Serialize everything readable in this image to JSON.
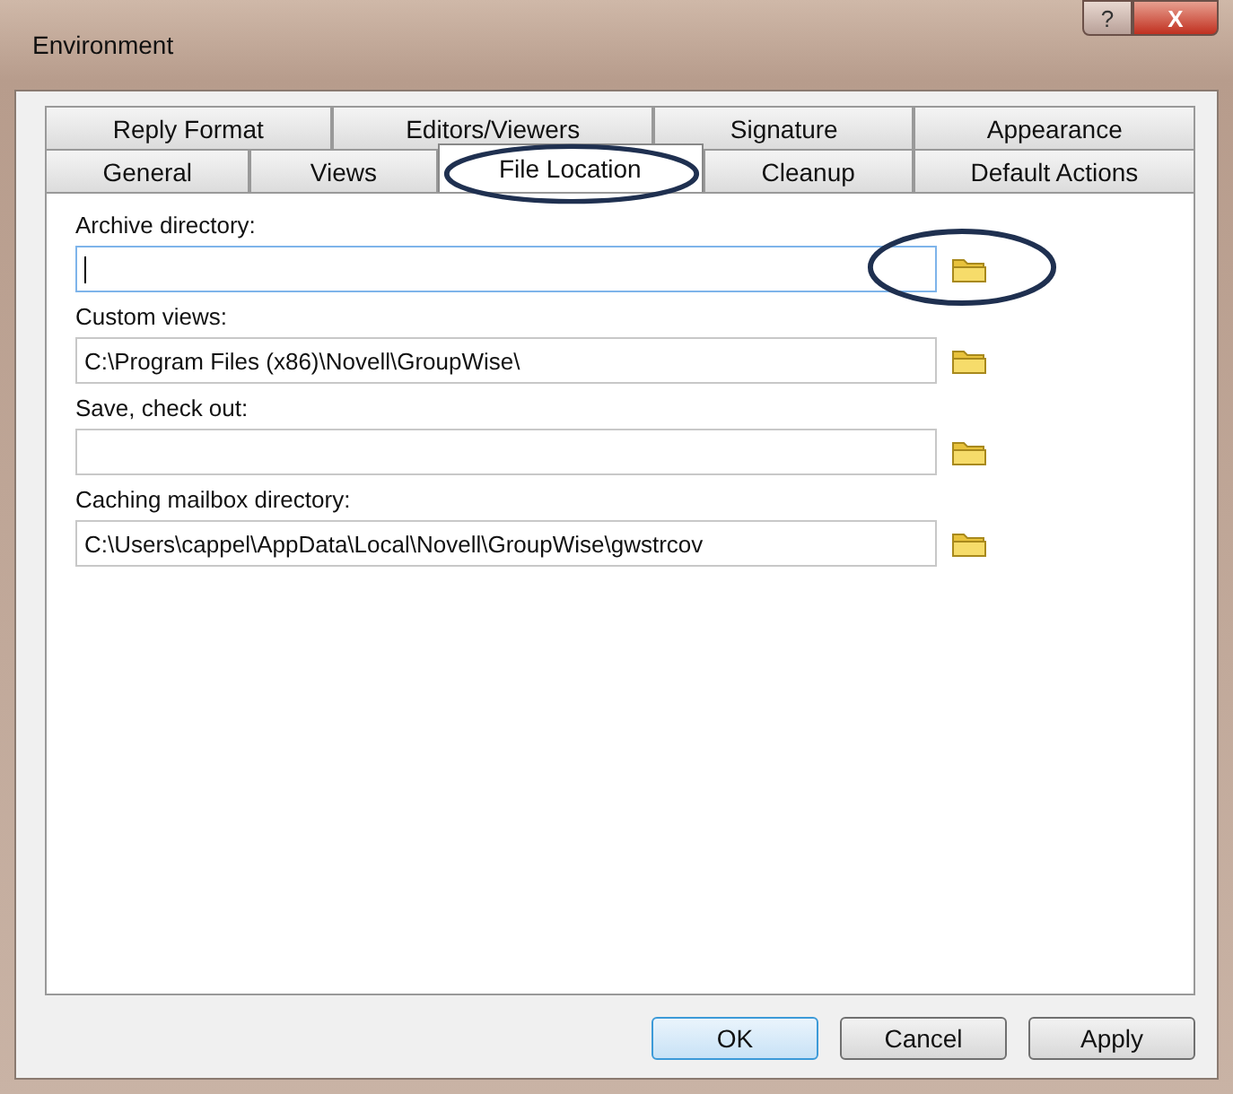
{
  "window": {
    "title": "Environment",
    "help_button": "?",
    "close_button": "X"
  },
  "tab_rows": [
    [
      {
        "label": "Reply Format",
        "selected": false,
        "circled": false
      },
      {
        "label": "Editors/Viewers",
        "selected": false,
        "circled": false
      },
      {
        "label": "Signature",
        "selected": false,
        "circled": false
      },
      {
        "label": "Appearance",
        "selected": false,
        "circled": false
      }
    ],
    [
      {
        "label": "General",
        "selected": false,
        "circled": false
      },
      {
        "label": "Views",
        "selected": false,
        "circled": false
      },
      {
        "label": "File Location",
        "selected": true,
        "circled": true
      },
      {
        "label": "Cleanup",
        "selected": false,
        "circled": false
      },
      {
        "label": "Default Actions",
        "selected": false,
        "circled": false
      }
    ]
  ],
  "fields": [
    {
      "label": "Archive directory:",
      "focused": true,
      "circled": true
    },
    {
      "label": "Custom views:",
      "value": "C:\\Program Files (x86)\\Novell\\GroupWise\\",
      "focused": false,
      "circled": false
    },
    {
      "label": "Save, check out:",
      "focused": false,
      "circled": false
    },
    {
      "label": "Caching mailbox directory:",
      "value": "C:\\Users\\cappel\\AppData\\Local\\Novell\\GroupWise\\gwstrcov",
      "focused": false,
      "circled": false
    }
  ],
  "buttons": [
    {
      "label": "OK",
      "default": true
    },
    {
      "label": "Cancel",
      "default": false
    },
    {
      "label": "Apply",
      "default": false
    }
  ]
}
